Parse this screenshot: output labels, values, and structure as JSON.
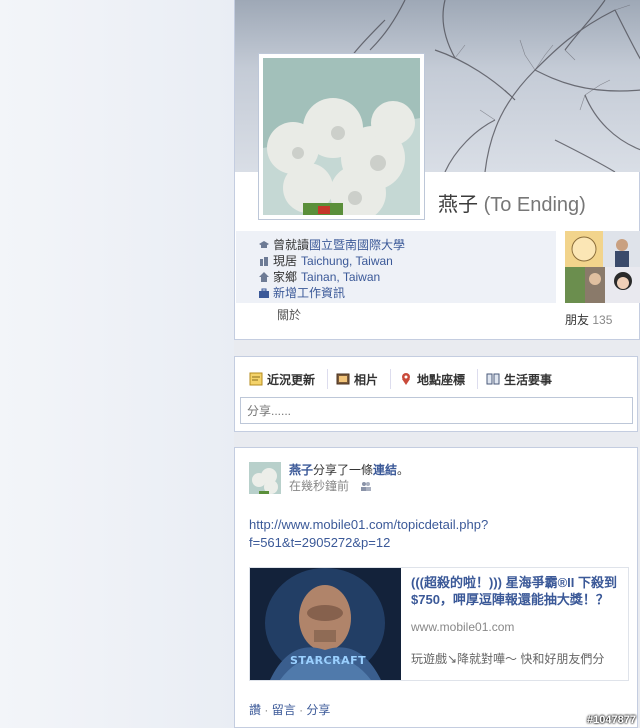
{
  "profile": {
    "name": "燕子",
    "alt_name": "(To Ending)",
    "studied_prefix": "曾就讀",
    "studied_school": "國立暨南國際大學",
    "lives_prefix": "現居",
    "lives_in": "Taichung, Taiwan",
    "from_prefix": "家鄉",
    "from": "Tainan, Taiwan",
    "add_work": "新增工作資訊",
    "about": "關於",
    "friends_label": "朋友",
    "friends_count": "135"
  },
  "composer": {
    "tabs": [
      {
        "label": "近況更新",
        "icon": "status-icon"
      },
      {
        "label": "相片",
        "icon": "photo-icon"
      },
      {
        "label": "地點座標",
        "icon": "place-icon"
      },
      {
        "label": "生活要事",
        "icon": "life-event-icon"
      }
    ],
    "placeholder": "分享......"
  },
  "post": {
    "author": "燕子",
    "action": "分享了一條",
    "action_link": "連結",
    "action_end": "。",
    "time": "在幾秒鐘前",
    "url_line1": "http://www.mobile01.com/topicdetail.php?",
    "url_line2": "f=561&t=2905272&p=12",
    "attachment": {
      "title": "(((超殺的啦！))) 星海爭霸®II 下殺到$750，呷厚逗陣報還能抽大獎！？",
      "domain": "www.mobile01.com",
      "description": "玩遊戲↘降就對嘩～ 快和好朋友們分",
      "logo_text": "STARCRAFT"
    },
    "actions": [
      "讚",
      "留言",
      "分享"
    ],
    "separator": "·"
  },
  "watermark": "#1047877",
  "colors": {
    "link": "#3b5998",
    "page_bg": "#e9ebf0",
    "border": "#c4cde0"
  }
}
